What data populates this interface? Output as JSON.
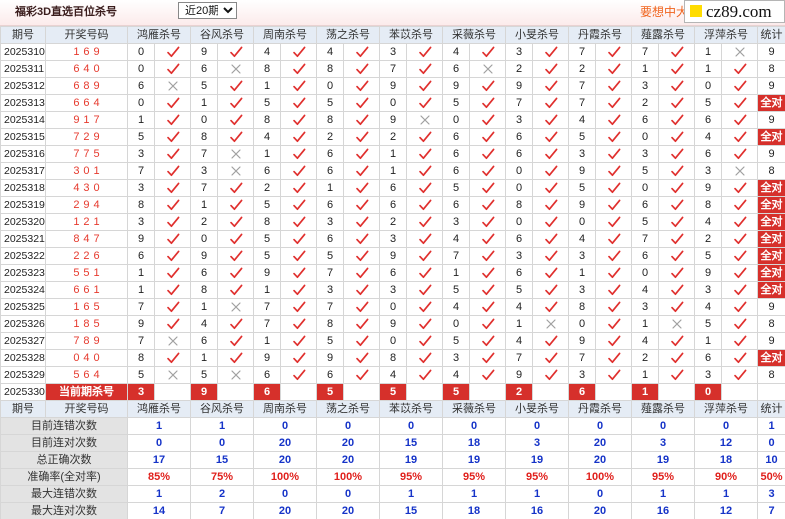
{
  "header": {
    "title": "福彩3D直选百位杀号",
    "period_select": "近20期",
    "promo_text": "要想中大",
    "watermark": "cz89.com"
  },
  "colors": {
    "check": "#e0302e",
    "cross": "#a0a0a0",
    "highlight": "#d6302b",
    "draw": "#e63a2e",
    "promo": "#f0641e",
    "logo": "#ffdc00"
  },
  "columns": {
    "issue": "期号",
    "draw": "开奖号码",
    "killers": [
      "鸿雁杀号",
      "谷风杀号",
      "周南杀号",
      "荡之杀号",
      "苯苡杀号",
      "采薇杀号",
      "小旻杀号",
      "丹霞杀号",
      "薤露杀号",
      "浮萍杀号"
    ],
    "stat": "统计"
  },
  "rows": [
    {
      "issue": "2025310",
      "draw": "169",
      "kills": [
        "0",
        "9",
        "4",
        "4",
        "3",
        "4",
        "3",
        "7",
        "7",
        "1"
      ],
      "marks": [
        "check-icon",
        "check-icon",
        "check-icon",
        "check-icon",
        "check-icon",
        "check-icon",
        "check-icon",
        "check-icon",
        "check-icon",
        "cross-icon"
      ],
      "stat": "9"
    },
    {
      "issue": "2025311",
      "draw": "640",
      "kills": [
        "0",
        "6",
        "8",
        "8",
        "7",
        "6",
        "2",
        "2",
        "1",
        "1"
      ],
      "marks": [
        "check-icon",
        "cross-icon",
        "check-icon",
        "check-icon",
        "check-icon",
        "cross-icon",
        "check-icon",
        "check-icon",
        "check-icon",
        "check-icon"
      ],
      "stat": "8"
    },
    {
      "issue": "2025312",
      "draw": "689",
      "kills": [
        "6",
        "5",
        "1",
        "0",
        "9",
        "9",
        "9",
        "7",
        "3",
        "0"
      ],
      "marks": [
        "cross-icon",
        "check-icon",
        "check-icon",
        "check-icon",
        "check-icon",
        "check-icon",
        "check-icon",
        "check-icon",
        "check-icon",
        "check-icon"
      ],
      "stat": "9"
    },
    {
      "issue": "2025313",
      "draw": "664",
      "kills": [
        "0",
        "1",
        "5",
        "5",
        "0",
        "5",
        "7",
        "7",
        "2",
        "5"
      ],
      "marks": [
        "check-icon",
        "check-icon",
        "check-icon",
        "check-icon",
        "check-icon",
        "check-icon",
        "check-icon",
        "check-icon",
        "check-icon",
        "check-icon"
      ],
      "stat": "全对"
    },
    {
      "issue": "2025314",
      "draw": "917",
      "kills": [
        "1",
        "0",
        "8",
        "8",
        "9",
        "0",
        "3",
        "4",
        "6",
        "6"
      ],
      "marks": [
        "check-icon",
        "check-icon",
        "check-icon",
        "check-icon",
        "cross-icon",
        "check-icon",
        "check-icon",
        "check-icon",
        "check-icon",
        "check-icon"
      ],
      "stat": "9"
    },
    {
      "issue": "2025315",
      "draw": "729",
      "kills": [
        "5",
        "8",
        "4",
        "2",
        "2",
        "6",
        "6",
        "5",
        "0",
        "4"
      ],
      "marks": [
        "check-icon",
        "check-icon",
        "check-icon",
        "check-icon",
        "check-icon",
        "check-icon",
        "check-icon",
        "check-icon",
        "check-icon",
        "check-icon"
      ],
      "stat": "全对"
    },
    {
      "issue": "2025316",
      "draw": "775",
      "kills": [
        "3",
        "7",
        "1",
        "6",
        "1",
        "6",
        "6",
        "3",
        "3",
        "6"
      ],
      "marks": [
        "check-icon",
        "cross-icon",
        "check-icon",
        "check-icon",
        "check-icon",
        "check-icon",
        "check-icon",
        "check-icon",
        "check-icon",
        "check-icon"
      ],
      "stat": "9"
    },
    {
      "issue": "2025317",
      "draw": "301",
      "kills": [
        "7",
        "3",
        "6",
        "6",
        "1",
        "6",
        "0",
        "9",
        "5",
        "3"
      ],
      "marks": [
        "check-icon",
        "cross-icon",
        "check-icon",
        "check-icon",
        "check-icon",
        "check-icon",
        "check-icon",
        "check-icon",
        "check-icon",
        "cross-icon"
      ],
      "stat": "8"
    },
    {
      "issue": "2025318",
      "draw": "430",
      "kills": [
        "3",
        "7",
        "2",
        "1",
        "6",
        "5",
        "0",
        "5",
        "0",
        "9"
      ],
      "marks": [
        "check-icon",
        "check-icon",
        "check-icon",
        "check-icon",
        "check-icon",
        "check-icon",
        "check-icon",
        "check-icon",
        "check-icon",
        "check-icon"
      ],
      "stat": "全对"
    },
    {
      "issue": "2025319",
      "draw": "294",
      "kills": [
        "8",
        "1",
        "5",
        "6",
        "6",
        "6",
        "8",
        "9",
        "6",
        "8"
      ],
      "marks": [
        "check-icon",
        "check-icon",
        "check-icon",
        "check-icon",
        "check-icon",
        "check-icon",
        "check-icon",
        "check-icon",
        "check-icon",
        "check-icon"
      ],
      "stat": "全对"
    },
    {
      "issue": "2025320",
      "draw": "121",
      "kills": [
        "3",
        "2",
        "8",
        "3",
        "2",
        "3",
        "0",
        "0",
        "5",
        "4"
      ],
      "marks": [
        "check-icon",
        "check-icon",
        "check-icon",
        "check-icon",
        "check-icon",
        "check-icon",
        "check-icon",
        "check-icon",
        "check-icon",
        "check-icon"
      ],
      "stat": "全对"
    },
    {
      "issue": "2025321",
      "draw": "847",
      "kills": [
        "9",
        "0",
        "5",
        "6",
        "3",
        "4",
        "6",
        "4",
        "7",
        "2"
      ],
      "marks": [
        "check-icon",
        "check-icon",
        "check-icon",
        "check-icon",
        "check-icon",
        "check-icon",
        "check-icon",
        "check-icon",
        "check-icon",
        "check-icon"
      ],
      "stat": "全对"
    },
    {
      "issue": "2025322",
      "draw": "226",
      "kills": [
        "6",
        "9",
        "5",
        "5",
        "9",
        "7",
        "3",
        "3",
        "6",
        "5"
      ],
      "marks": [
        "check-icon",
        "check-icon",
        "check-icon",
        "check-icon",
        "check-icon",
        "check-icon",
        "check-icon",
        "check-icon",
        "check-icon",
        "check-icon"
      ],
      "stat": "全对"
    },
    {
      "issue": "2025323",
      "draw": "551",
      "kills": [
        "1",
        "6",
        "9",
        "7",
        "6",
        "1",
        "6",
        "1",
        "0",
        "9"
      ],
      "marks": [
        "check-icon",
        "check-icon",
        "check-icon",
        "check-icon",
        "check-icon",
        "check-icon",
        "check-icon",
        "check-icon",
        "check-icon",
        "check-icon"
      ],
      "stat": "全对"
    },
    {
      "issue": "2025324",
      "draw": "661",
      "kills": [
        "1",
        "8",
        "1",
        "3",
        "3",
        "5",
        "5",
        "3",
        "4",
        "3"
      ],
      "marks": [
        "check-icon",
        "check-icon",
        "check-icon",
        "check-icon",
        "check-icon",
        "check-icon",
        "check-icon",
        "check-icon",
        "check-icon",
        "check-icon"
      ],
      "stat": "全对"
    },
    {
      "issue": "2025325",
      "draw": "165",
      "kills": [
        "7",
        "1",
        "7",
        "7",
        "0",
        "4",
        "4",
        "8",
        "3",
        "4"
      ],
      "marks": [
        "check-icon",
        "cross-icon",
        "check-icon",
        "check-icon",
        "check-icon",
        "check-icon",
        "check-icon",
        "check-icon",
        "check-icon",
        "check-icon"
      ],
      "stat": "9"
    },
    {
      "issue": "2025326",
      "draw": "185",
      "kills": [
        "9",
        "4",
        "7",
        "8",
        "9",
        "0",
        "1",
        "0",
        "1",
        "5"
      ],
      "marks": [
        "check-icon",
        "check-icon",
        "check-icon",
        "check-icon",
        "check-icon",
        "check-icon",
        "cross-icon",
        "check-icon",
        "cross-icon",
        "check-icon"
      ],
      "stat": "8"
    },
    {
      "issue": "2025327",
      "draw": "789",
      "kills": [
        "7",
        "6",
        "1",
        "5",
        "0",
        "5",
        "4",
        "9",
        "4",
        "1"
      ],
      "marks": [
        "cross-icon",
        "check-icon",
        "check-icon",
        "check-icon",
        "check-icon",
        "check-icon",
        "check-icon",
        "check-icon",
        "check-icon",
        "check-icon"
      ],
      "stat": "9"
    },
    {
      "issue": "2025328",
      "draw": "040",
      "kills": [
        "8",
        "1",
        "9",
        "9",
        "8",
        "3",
        "7",
        "7",
        "2",
        "6"
      ],
      "marks": [
        "check-icon",
        "check-icon",
        "check-icon",
        "check-icon",
        "check-icon",
        "check-icon",
        "check-icon",
        "check-icon",
        "check-icon",
        "check-icon"
      ],
      "stat": "全对"
    },
    {
      "issue": "2025329",
      "draw": "564",
      "kills": [
        "5",
        "5",
        "6",
        "6",
        "4",
        "4",
        "9",
        "3",
        "1",
        "3"
      ],
      "marks": [
        "cross-icon",
        "cross-icon",
        "check-icon",
        "check-icon",
        "check-icon",
        "check-icon",
        "check-icon",
        "check-icon",
        "check-icon",
        "check-icon"
      ],
      "stat": "8"
    }
  ],
  "current": {
    "issue": "2025330",
    "label": "当前期杀号",
    "kills": [
      "3",
      "9",
      "6",
      "5",
      "5",
      "5",
      "2",
      "6",
      "1",
      "0"
    ]
  },
  "stats": [
    {
      "label": "目前连错次数",
      "values": [
        "1",
        "1",
        "0",
        "0",
        "0",
        "0",
        "0",
        "0",
        "0",
        "0",
        "1"
      ],
      "color": "#1533c8"
    },
    {
      "label": "目前连对次数",
      "values": [
        "0",
        "0",
        "20",
        "20",
        "15",
        "18",
        "3",
        "20",
        "3",
        "12",
        "0"
      ],
      "color": "#1533c8"
    },
    {
      "label": "总正确次数",
      "values": [
        "17",
        "15",
        "20",
        "20",
        "19",
        "19",
        "19",
        "20",
        "19",
        "18",
        "10"
      ],
      "color": "#1533c8"
    },
    {
      "label": "准确率(全对率)",
      "values": [
        "85%",
        "75%",
        "100%",
        "100%",
        "95%",
        "95%",
        "95%",
        "100%",
        "95%",
        "90%",
        "50%"
      ],
      "color": "#e0201c"
    },
    {
      "label": "最大连错次数",
      "values": [
        "1",
        "2",
        "0",
        "0",
        "1",
        "1",
        "1",
        "0",
        "1",
        "1",
        "3"
      ],
      "color": "#1533c8"
    },
    {
      "label": "最大连对次数",
      "values": [
        "14",
        "7",
        "20",
        "20",
        "15",
        "18",
        "16",
        "20",
        "16",
        "12",
        "7"
      ],
      "color": "#1533c8"
    }
  ]
}
